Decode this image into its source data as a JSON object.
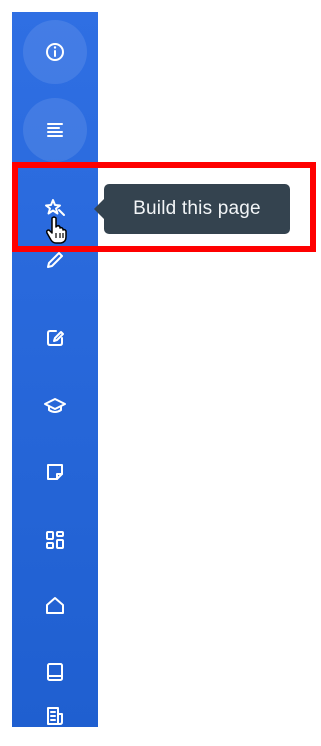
{
  "sidebar": {
    "accent": "#2f6fe3",
    "items": [
      {
        "icon": "info-icon",
        "active": true
      },
      {
        "icon": "lines-icon",
        "active": true
      },
      {
        "icon": "magic-star-icon"
      },
      {
        "icon": "pencil-icon"
      },
      {
        "icon": "edit-note-icon"
      },
      {
        "icon": "graduation-cap-icon"
      },
      {
        "icon": "sticky-note-icon"
      },
      {
        "icon": "dashboard-grid-icon"
      },
      {
        "icon": "home-icon"
      },
      {
        "icon": "book-icon"
      },
      {
        "icon": "document-icon"
      }
    ]
  },
  "tooltip": {
    "text": "Build this page"
  },
  "highlight": {
    "color": "#ff0000"
  }
}
